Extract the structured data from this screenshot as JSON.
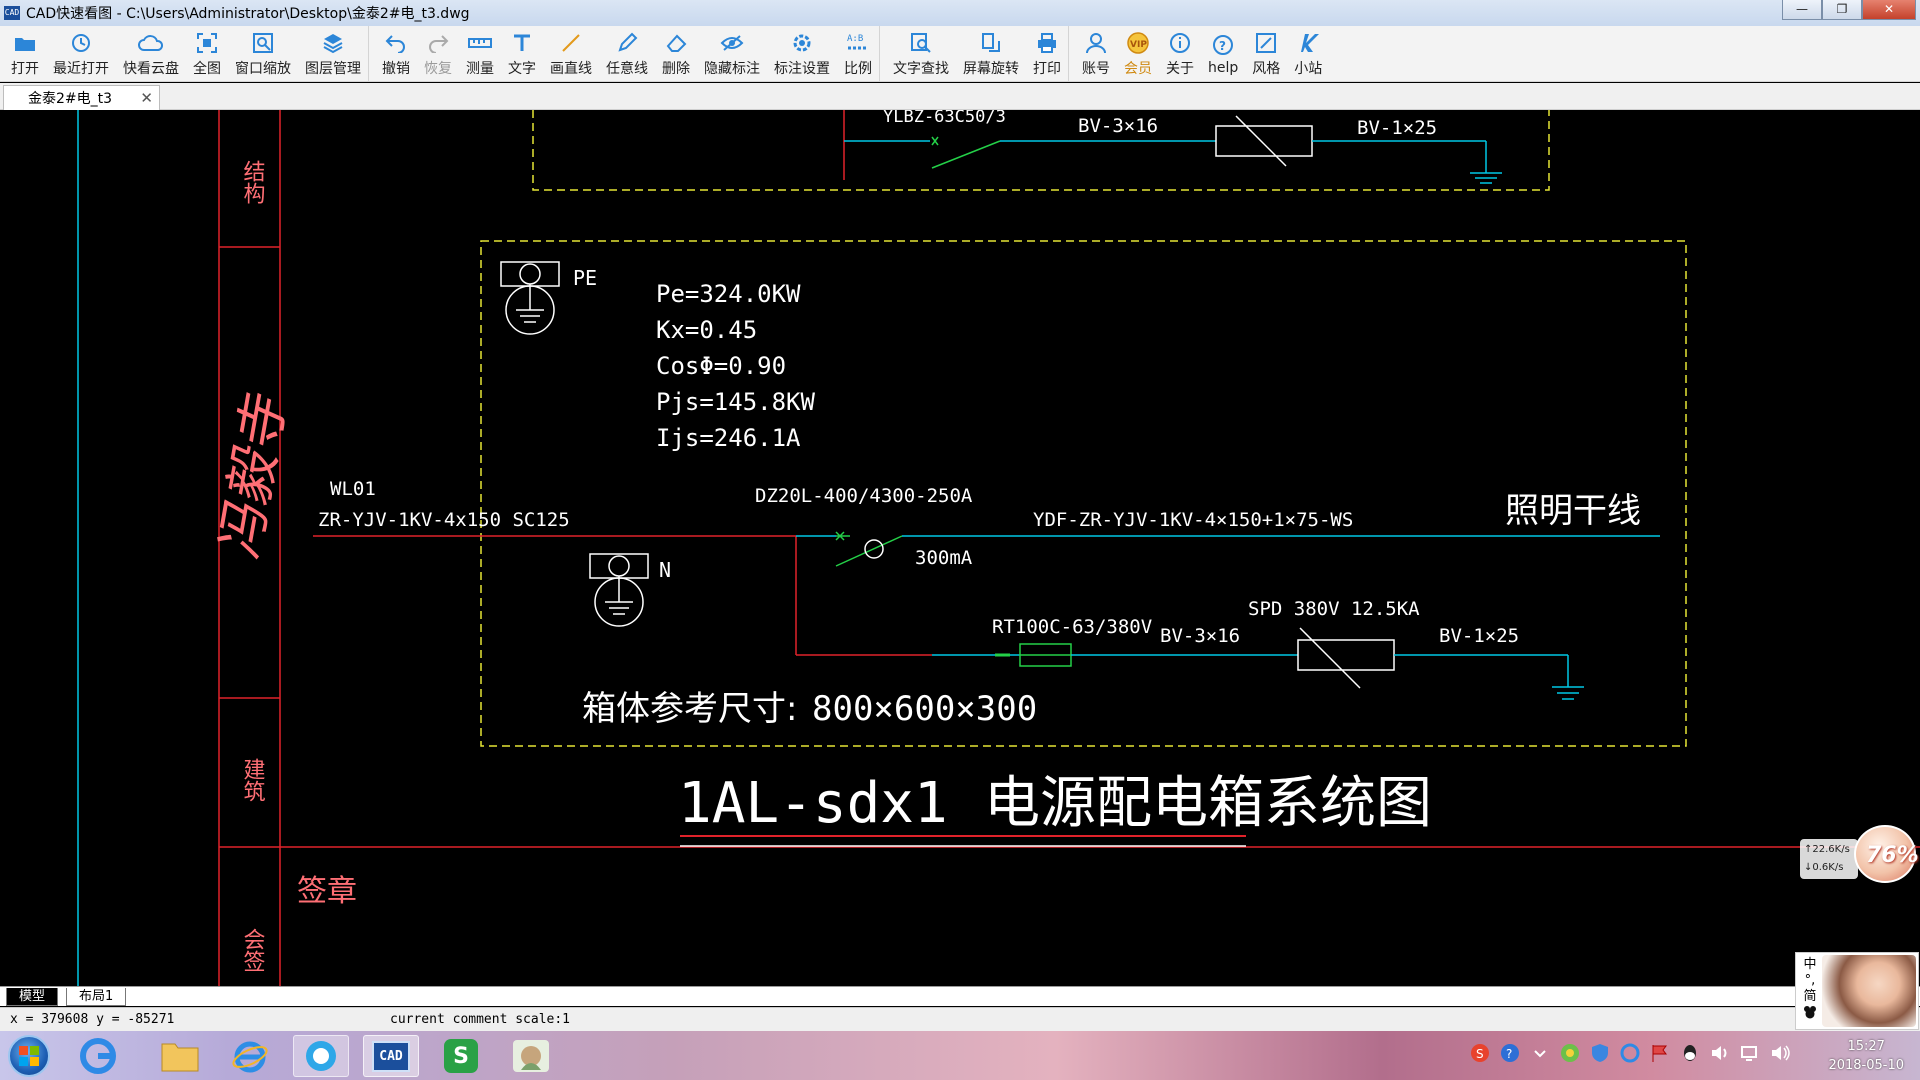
{
  "window": {
    "app_icon_text": "CAD",
    "title": "CAD快速看图 - C:\\Users\\Administrator\\Desktop\\金泰2#电_t3.dwg",
    "btn_minimize": "—",
    "btn_maximize": "❐",
    "btn_close": "✕"
  },
  "toolbar": {
    "open": "打开",
    "recent": "最近打开",
    "cloud": "快看云盘",
    "fit": "全图",
    "window_zoom": "窗口缩放",
    "layers": "图层管理",
    "undo": "撤销",
    "redo": "恢复",
    "measure": "测量",
    "text": "文字",
    "line": "画直线",
    "polyline": "任意线",
    "delete": "删除",
    "hide_marks": "隐藏标注",
    "mark_settings": "标注设置",
    "scale": "比例",
    "find_text": "文字查找",
    "rotate": "屏幕旋转",
    "print": "打印",
    "account": "账号",
    "vip": "会员",
    "about": "关于",
    "help": "help",
    "style": "风格",
    "station": "小站"
  },
  "tab": {
    "name": "金泰2#电_t3",
    "close": "✕"
  },
  "drawing": {
    "top_breaker": "YLBZ-63C50/3",
    "top_bv_a": "BV-3×16",
    "top_bv_b": "BV-1×25",
    "pe": "PE",
    "n": "N",
    "pe_load": "Pe=324.0KW",
    "kx": "Kx=0.45",
    "cos": "CosΦ=0.90",
    "pjs": "Pjs=145.8KW",
    "ijs": "Ijs=246.1A",
    "wl": "WL01",
    "incoming_cable": "ZR-YJV-1KV-4x150 SC125",
    "main_breaker": "DZ20L-400/4300-250A",
    "rcd": "300mA",
    "outgoing_cable": "YDF-ZR-YJV-1KV-4×150+1×75-WS",
    "trunk": "照明干线",
    "fuse": "RT100C-63/380V",
    "bv_a": "BV-3×16",
    "spd": "SPD 380V 12.5KA",
    "bv_b": "BV-1×25",
    "box_label": "箱体参考尺寸:",
    "box_size": "800×600×300",
    "diagram_id": "1AL-sdx1",
    "diagram_title": "电源配电箱系统图",
    "col_structure": "结构",
    "col_arch": "建筑",
    "col_sign": "会签",
    "stamp": "签章",
    "signature": "冯毅寺"
  },
  "layout_tabs": {
    "model": "模型",
    "layout1": "布局1"
  },
  "status": {
    "coords": "x = 379608 y = -85271",
    "scale": "current comment scale:1"
  },
  "net": {
    "up": "↑22.6K/s",
    "down": "↓0.6K/s",
    "percent": "76%"
  },
  "ime": {
    "chars": [
      "中",
      "°,",
      "简"
    ]
  },
  "taskbar": {
    "clock_time": "15:27",
    "clock_date": "2018-05-10",
    "cad_label": "CAD",
    "wps_label": "S"
  },
  "colors": {
    "cad_bg": "#000000",
    "cad_white": "#ffffff",
    "cad_cyan": "#00c8e6",
    "cad_red": "#e0222a",
    "cad_yellow": "#e6e635",
    "cad_green": "#24d048",
    "cad_pink": "#ff6f75"
  }
}
